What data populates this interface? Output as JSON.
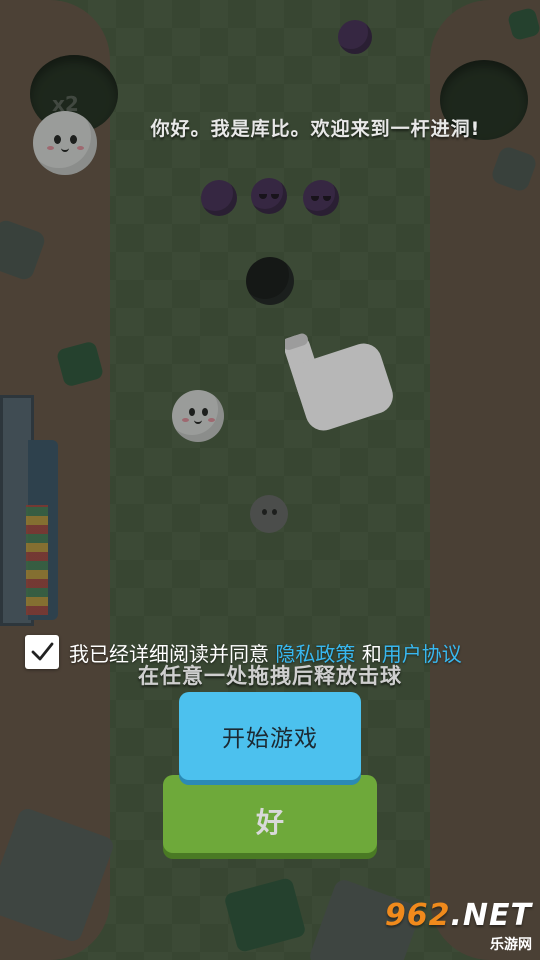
{
  "dialog": {
    "greeting": "你好。我是库比。欢迎来到一杆进洞!"
  },
  "game": {
    "instruction": "在任意一处拖拽后释放击球",
    "hole_multiplier_label": "x2"
  },
  "agreement": {
    "checked": true,
    "prefix": "我已经详细阅读并同意 ",
    "privacy_link": "隐私政策",
    "conjunction": " 和",
    "terms_link": "用户协议"
  },
  "buttons": {
    "start_label": "开始游戏",
    "ok_label": "好"
  },
  "watermark": {
    "brand_number": "962",
    "brand_suffix": ".NET",
    "brand_sub": "乐游网"
  },
  "colors": {
    "start_button": "#4cc1ee",
    "ok_button": "#6ea93a",
    "link": "#38b8f0"
  }
}
